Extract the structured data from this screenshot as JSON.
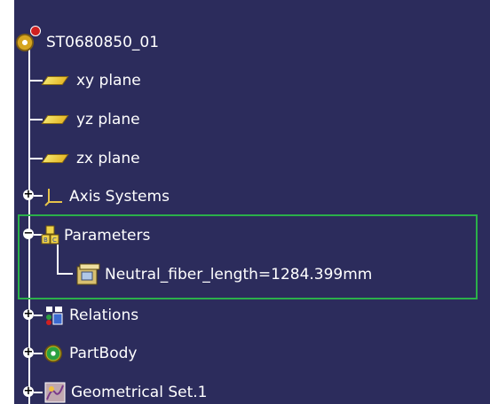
{
  "tree": {
    "root": {
      "label": "ST0680850_01",
      "icon": "part-root-icon"
    },
    "items": [
      {
        "label": "xy plane",
        "icon": "plane-icon"
      },
      {
        "label": "yz plane",
        "icon": "plane-icon"
      },
      {
        "label": "zx plane",
        "icon": "plane-icon"
      },
      {
        "label": "Axis Systems",
        "icon": "axis-system-icon",
        "expander": "+"
      },
      {
        "label": "Parameters",
        "icon": "parameters-icon",
        "expander": "−"
      },
      {
        "label": "Neutral_fiber_length=1284.399mm",
        "icon": "parameter-value-icon"
      },
      {
        "label": "Relations",
        "icon": "relations-icon",
        "expander": "+"
      },
      {
        "label": "PartBody",
        "icon": "partbody-icon",
        "expander": "+"
      },
      {
        "label": "Geometrical Set.1",
        "icon": "geometrical-set-icon",
        "expander": "+"
      }
    ]
  },
  "colors": {
    "background": "#2c2c5c",
    "highlight_border": "#2bb04a",
    "text": "#ffffff"
  }
}
